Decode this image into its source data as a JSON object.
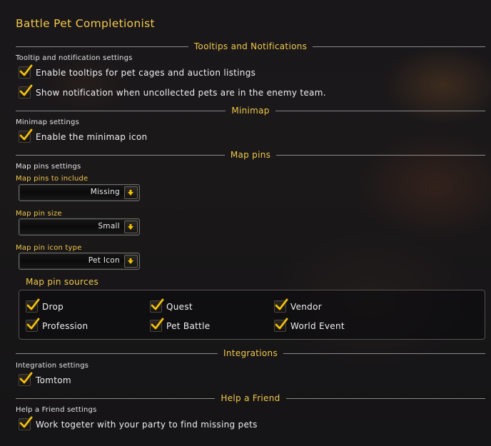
{
  "title": "Battle Pet Completionist",
  "sections": {
    "tooltips": {
      "header": "Tooltips and Notifications",
      "sublabel": "Tooltip and notification settings",
      "options": [
        {
          "label": "Enable tooltips for pet cages and auction listings",
          "checked": true
        },
        {
          "label": "Show notification when uncollected pets are in the enemy team.",
          "checked": true
        }
      ]
    },
    "minimap": {
      "header": "Minimap",
      "sublabel": "Minimap settings",
      "options": [
        {
          "label": "Enable the minimap icon",
          "checked": true
        }
      ]
    },
    "mappins": {
      "header": "Map pins",
      "sublabel": "Map pins settings",
      "dropdowns": [
        {
          "label": "Map pins to include",
          "value": "Missing"
        },
        {
          "label": "Map pin size",
          "value": "Small"
        },
        {
          "label": "Map pin icon type",
          "value": "Pet Icon"
        }
      ],
      "sources_title": "Map pin sources",
      "sources": [
        {
          "label": "Drop",
          "checked": true
        },
        {
          "label": "Quest",
          "checked": true
        },
        {
          "label": "Vendor",
          "checked": true
        },
        {
          "label": "Profession",
          "checked": true
        },
        {
          "label": "Pet Battle",
          "checked": true
        },
        {
          "label": "World Event",
          "checked": true
        }
      ]
    },
    "integrations": {
      "header": "Integrations",
      "sublabel": "Integration settings",
      "options": [
        {
          "label": "Tomtom",
          "checked": true
        }
      ]
    },
    "helpfriend": {
      "header": "Help a Friend",
      "sublabel": "Help a Friend settings",
      "options": [
        {
          "label": "Work togeter with your party to find missing pets",
          "checked": true
        }
      ]
    }
  },
  "colors": {
    "accent": "#f2c94c",
    "text": "#f0f0f0",
    "divider": "#8a8a8a"
  },
  "icons": {
    "checkbox": "checkmark-icon",
    "dropdown": "arrow-down-icon"
  }
}
